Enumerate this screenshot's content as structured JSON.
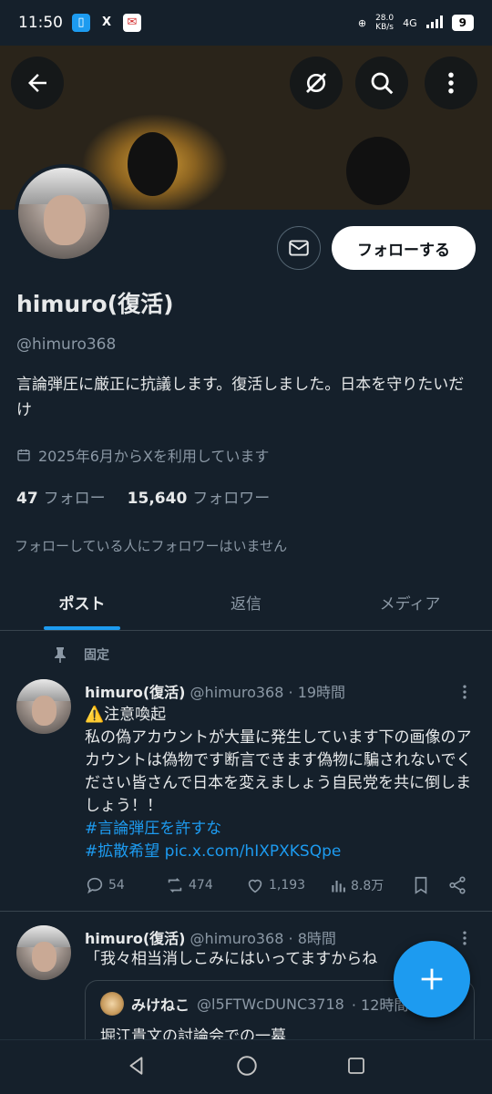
{
  "status_bar": {
    "time": "11:50",
    "apps": [
      "X"
    ],
    "net_speed_value": "28.0",
    "net_speed_unit": "KB/s",
    "network": "4G",
    "battery": "9"
  },
  "profile": {
    "name": "himuro(復活)",
    "handle": "@himuro368",
    "bio": "言論弾圧に厳正に抗議します。復活しました。日本を守りたいだけ",
    "joined": "2025年6月からXを利用しています",
    "following_count": "47",
    "following_label": "フォロー",
    "followers_count": "15,640",
    "followers_label": "フォロワー",
    "followers_you_know": "フォローしている人にフォロワーはいません",
    "follow_button": "フォローする"
  },
  "tabs": [
    {
      "label": "ポスト",
      "active": true
    },
    {
      "label": "返信",
      "active": false
    },
    {
      "label": "メディア",
      "active": false
    }
  ],
  "pinned_label": "固定",
  "tweets": [
    {
      "name": "himuro(復活)",
      "handle": "@himuro368",
      "time": "· 19時間",
      "line1": "⚠️注意喚起",
      "line2": "私の偽アカウントが大量に発生しています下の画像のアカウントは偽物です断言できます偽物に騙されないでください皆さんで日本を変えましょう自民党を共に倒しましょう！！",
      "hashtag1": "#言論弾圧を許すな",
      "hashtag2": "#拡散希望",
      "link": "pic.x.com/hIXPXKSQpe",
      "replies": "54",
      "reposts": "474",
      "likes": "1,193",
      "views": "8.8万"
    },
    {
      "name": "himuro(復活)",
      "handle": "@himuro368",
      "time": "· 8時間",
      "text": "「我々相当消しこみにはいってますからね",
      "quote": {
        "name": "みけねこ",
        "handle": "@l5FTWcDUNC3718",
        "time": "· 12時間",
        "text": "堀江貴文の討論会での一幕"
      }
    }
  ],
  "colors": {
    "accent": "#1d9bf0",
    "background": "#15202b",
    "text_secondary": "#8b98a5"
  }
}
